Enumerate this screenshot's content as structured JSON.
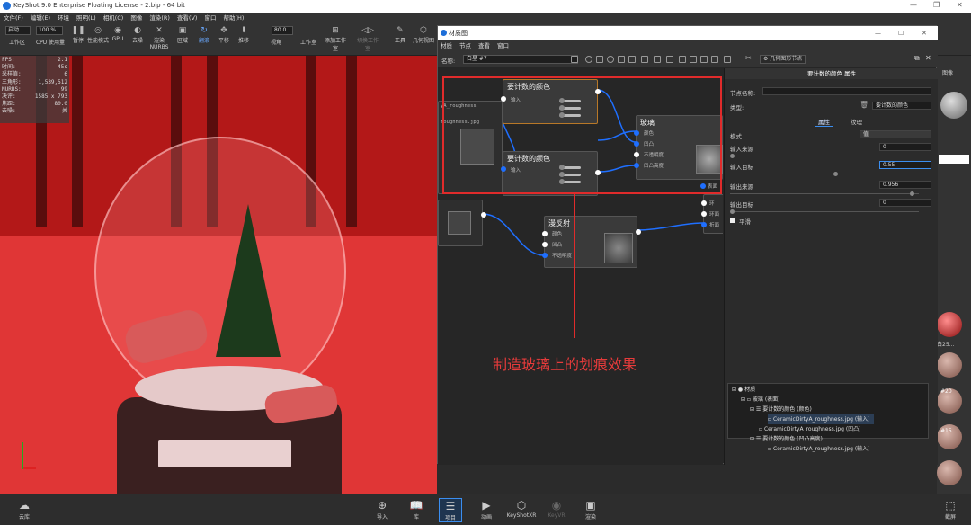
{
  "app": {
    "title": "KeyShot 9.0 Enterprise Floating License  -  2.bip  -  64 bit"
  },
  "menu": [
    "文件(F)",
    "编辑(E)",
    "环境",
    "照明(L)",
    "相机(C)",
    "图像",
    "渲染(R)",
    "查看(V)",
    "窗口",
    "帮助(H)"
  ],
  "toolbar": {
    "start_label": "启动",
    "zoom_value": "100 %",
    "fov_value": "80.0",
    "items": [
      {
        "label": "工作区"
      },
      {
        "label": "CPU 使用量"
      },
      {
        "label": "暂停"
      },
      {
        "label": "性能模式"
      },
      {
        "label": "GPU"
      },
      {
        "label": "去噪"
      },
      {
        "label": "渲染 NURBS"
      },
      {
        "label": "区域"
      },
      {
        "label": "翻滚"
      },
      {
        "label": "平移"
      },
      {
        "label": "推移"
      },
      {
        "label": "视角"
      },
      {
        "label": "工作室"
      },
      {
        "label": "添加工作室"
      },
      {
        "label": "切换工作室"
      },
      {
        "label": "工具"
      },
      {
        "label": "几何视图"
      }
    ]
  },
  "stats": [
    {
      "k": "FPS:",
      "v": "2.1"
    },
    {
      "k": "时间:",
      "v": "45s"
    },
    {
      "k": "采样值:",
      "v": "6"
    },
    {
      "k": "三角形:",
      "v": "1,539,512"
    },
    {
      "k": "NURBS:",
      "v": "99"
    },
    {
      "k": "决评:",
      "v": "1585 x 793"
    },
    {
      "k": "焦距:",
      "v": "80.0"
    },
    {
      "k": "去噪:",
      "v": "关"
    }
  ],
  "material_window": {
    "title": "材质图",
    "menu": [
      "材质",
      "节点",
      "查看",
      "窗口"
    ],
    "name_label": "名称:",
    "name_value": "白星 #7",
    "geometry_btn": "几何图形节点",
    "nodes": {
      "color1": {
        "title": "要计数的颜色",
        "input": "输入"
      },
      "color2": {
        "title": "要计数的颜色",
        "input": "输入"
      },
      "glass": {
        "title": "玻璃",
        "ports": [
          "颜色",
          "凹凸",
          "不透明度",
          "凹凸高度"
        ]
      },
      "diffuse": {
        "title": "漫反射",
        "ports": [
          "颜色",
          "凹凸",
          "不透明度"
        ]
      },
      "texture_label": "yA_roughness",
      "texture_file": "roughness.jpg",
      "surface_label": "表面",
      "side_ports": [
        "环",
        "环面",
        "折面"
      ]
    }
  },
  "properties": {
    "header": "要计数的颜色 属性",
    "node_name_label": "节点名称:",
    "type_label": "类型:",
    "type_value": "要计数的颜色",
    "tabs": [
      "属性",
      "纹理"
    ],
    "mode_label": "模式",
    "mode_value": "值",
    "input_source_label": "输入来源",
    "input_source_value": "0",
    "input_target_label": "输入目标",
    "input_target_value": "0.55",
    "output_source_label": "输出来源",
    "output_source_value": "0.956",
    "output_target_label": "输出目标",
    "output_target_value": "0",
    "smooth_label": "平滑"
  },
  "scene_tree": [
    {
      "label": "材质"
    },
    {
      "label": "玻璃 (表面)"
    },
    {
      "label": "要计数的颜色 (颜色)"
    },
    {
      "label": "CeramicDirtyA_roughness.jpg (输入)"
    },
    {
      "label": "CeramicDirtyA_roughness.jpg (凹凸)"
    },
    {
      "label": "要计数的颜色 (凹凸高度)"
    },
    {
      "label": "CeramicDirtyA_roughness.jpg (输入)"
    }
  ],
  "right_panel": {
    "label_top": "图像",
    "ball_labels": [
      "白25...",
      "#20",
      "#15"
    ]
  },
  "annotation": "制造玻璃上的划痕效果",
  "bottom": {
    "cloud_label": "云库",
    "screenshot_label": "截屏",
    "items": [
      {
        "label": "导入"
      },
      {
        "label": "库"
      },
      {
        "label": "项目"
      },
      {
        "label": "动画"
      },
      {
        "label": "KeyShotXR"
      },
      {
        "label": "KeyVR"
      },
      {
        "label": "渲染"
      }
    ]
  },
  "colors": {
    "accent": "#1f6fff",
    "annotation": "#e02b2b",
    "viewport": "#c42424"
  }
}
